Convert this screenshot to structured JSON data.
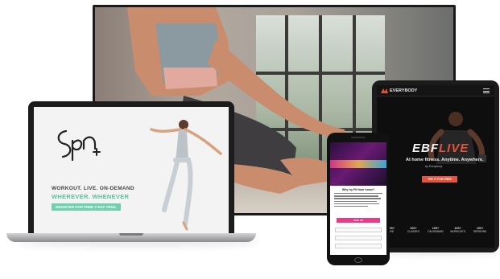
{
  "laptop": {
    "logo_text": "",
    "headline": "WORKOUT. LIVE. ON-DEMAND",
    "subheadline": "WHEREVER. WHENEVER",
    "cta": "REGISTER FOR FREE 7-DAY TRIAL"
  },
  "tablet": {
    "brand": "EVERYBODY",
    "title_main": "EBF",
    "title_accent": "LIVE",
    "subtitle": "At home fitness. Anytime. Anywhere.",
    "tagline": "by Everybody",
    "cta": "TRY IT FOR FREE",
    "stats": [
      {
        "num": "100+",
        "label": "LIVE"
      },
      {
        "num": "100+",
        "label": "CLASSES"
      },
      {
        "num": "100+",
        "label": "ON DEMAND"
      },
      {
        "num": "100+",
        "label": "WORKOUTS"
      },
      {
        "num": "100+",
        "label": "SESSIONS"
      }
    ]
  },
  "phone": {
    "title": "Why try Fit from home?",
    "cta": "SIGN UP"
  },
  "colors": {
    "laptop_accent": "#5bbf9c",
    "tablet_accent": "#e4533b",
    "phone_accent": "#e93b8a"
  }
}
